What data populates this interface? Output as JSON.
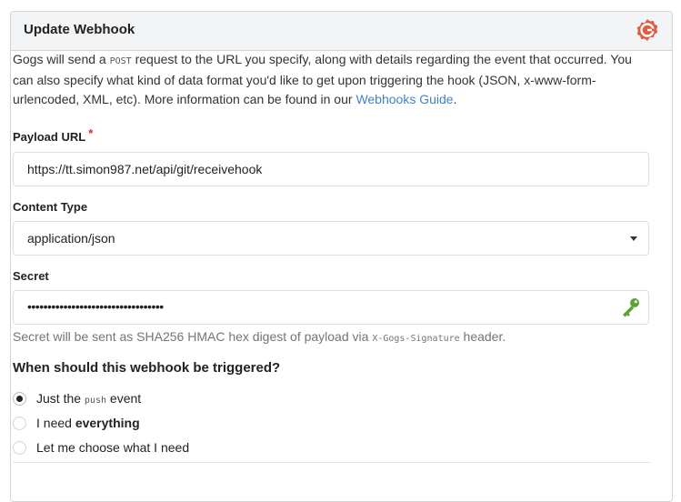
{
  "header": {
    "title": "Update Webhook",
    "logo_icon": "gogs-logo-icon",
    "brand_color": "#e05d44"
  },
  "intro": {
    "part1": "Gogs will send a ",
    "method": "POST",
    "part2": " request to the URL you specify, along with details regarding the event that occurred. You can also specify what kind of data format you'd like to get upon triggering the hook (JSON, x-www-form-urlencoded, XML, etc). More information can be found in our ",
    "link_text": "Webhooks Guide",
    "part3": "."
  },
  "payload_url": {
    "label": "Payload URL",
    "required_mark": "*",
    "value": "https://tt.simon987.net/api/git/receivehook"
  },
  "content_type": {
    "label": "Content Type",
    "value": "application/json"
  },
  "secret": {
    "label": "Secret",
    "value": "••••••••••••••••••••••••••••••••••",
    "icon": "key-icon",
    "help_part1": "Secret will be sent as SHA256 HMAC hex digest of payload via ",
    "help_header": "X-Gogs-Signature",
    "help_part2": " header."
  },
  "trigger": {
    "question": "When should this webhook be triggered?",
    "options": [
      {
        "prefix": "Just the ",
        "code": "push",
        "suffix": " event",
        "checked": true
      },
      {
        "prefix": "I need ",
        "bold": "everything",
        "checked": false
      },
      {
        "label": "Let me choose what I need",
        "checked": false
      }
    ]
  }
}
